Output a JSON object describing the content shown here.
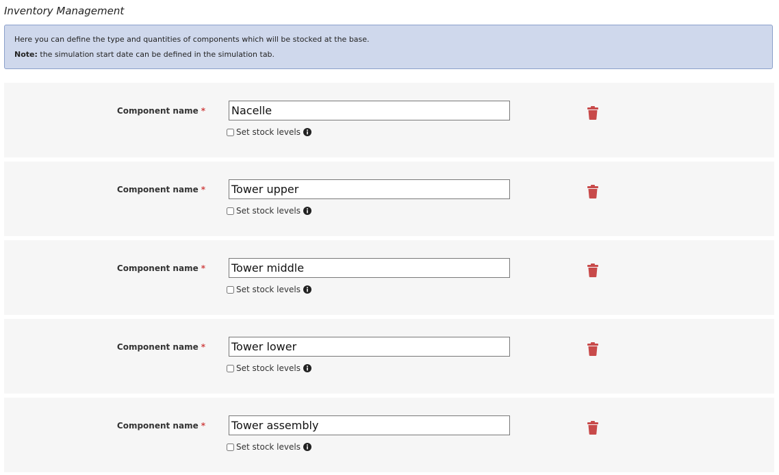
{
  "page": {
    "title": "Inventory Management"
  },
  "info": {
    "line1": "Here you can define the type and quantities of components which will be stocked at the base.",
    "note_label": "Note:",
    "note_text": " the simulation start date can be defined in the simulation tab."
  },
  "components": [
    {
      "label": "Component name",
      "required_mark": "*",
      "value": "Nacelle",
      "stock_label": "Set stock levels"
    },
    {
      "label": "Component name",
      "required_mark": "*",
      "value": "Tower upper",
      "stock_label": "Set stock levels"
    },
    {
      "label": "Component name",
      "required_mark": "*",
      "value": "Tower middle",
      "stock_label": "Set stock levels"
    },
    {
      "label": "Component name",
      "required_mark": "*",
      "value": "Tower lower",
      "stock_label": "Set stock levels"
    },
    {
      "label": "Component name",
      "required_mark": "*",
      "value": "Tower assembly",
      "stock_label": "Set stock levels"
    }
  ],
  "colors": {
    "info_bg": "#cfd8ec",
    "info_border": "#8a9fca",
    "row_bg": "#f6f6f6",
    "required": "#d04545",
    "delete": "#c84a4a"
  },
  "icons": {
    "delete": "trash-icon",
    "info": "info-circle-icon"
  }
}
